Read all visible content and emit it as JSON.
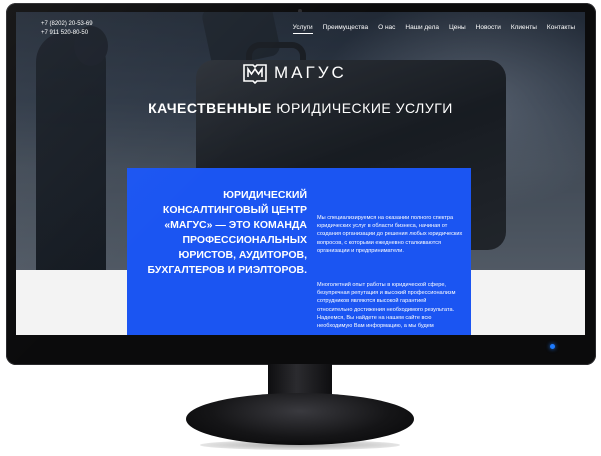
{
  "contacts": {
    "phone1": "+7 (8202) 20-53-69",
    "phone2": "+7 911 520-80-50"
  },
  "nav": [
    {
      "label": "Услуги",
      "active": true
    },
    {
      "label": "Преимущества",
      "active": false
    },
    {
      "label": "О нас",
      "active": false
    },
    {
      "label": "Наши дела",
      "active": false
    },
    {
      "label": "Цены",
      "active": false
    },
    {
      "label": "Новости",
      "active": false
    },
    {
      "label": "Клиенты",
      "active": false
    },
    {
      "label": "Контакты",
      "active": false
    }
  ],
  "logo": {
    "text": "МАГУС"
  },
  "tagline": {
    "bold": "КАЧЕСТВЕННЫЕ",
    "light": "ЮРИДИЧЕСКИЕ УСЛУГИ"
  },
  "intro": {
    "headline": "ЮРИДИЧЕСКИЙ КОНСАЛТИНГОВЫЙ ЦЕНТР «МАГУС» — ЭТО КОМАНДА ПРОФЕССИОНАЛЬНЫХ ЮРИСТОВ, АУДИТОРОВ, БУХГАЛТЕРОВ И РИЭЛТОРОВ.",
    "paragraph1": "Мы специализируемся на оказании полного спектра юридических услуг в области бизнеса, начиная от создания организации до решения любых юридических вопросов, с которыми ежедневно сталкиваются организации и предприниматели.",
    "paragraph2": "Многолетний опыт работы в юридической сфере, безупречная репутация и высокий профессионализм сотрудников являются высокой гарантией относительно достижения необходимого результата. Надеемся, Вы найдете на нашем сайте всю необходимую Вам информацию, а мы будем"
  },
  "colors": {
    "accent_blue": "#1b55f2",
    "power_led": "#1e7bff",
    "bezel": "#0b0b0c"
  }
}
